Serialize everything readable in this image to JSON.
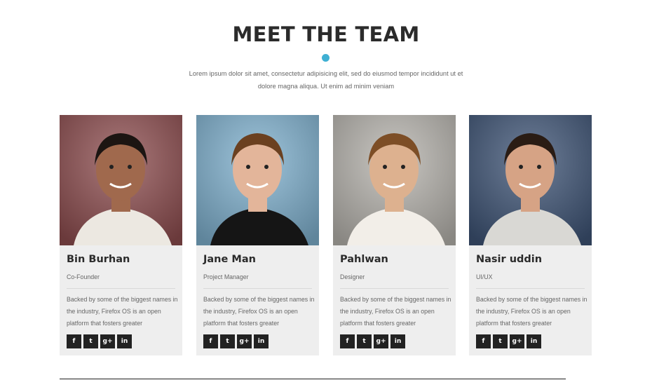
{
  "section": {
    "title": "MEET THE TEAM",
    "intro": "Lorem ipsum dolor sit amet, consectetur adipisicing elit, sed do eiusmod tempor incididunt ut et dolore magna aliqua. Ut enim ad minim veniam",
    "accent_color": "#3fb0d3"
  },
  "social_icons": [
    {
      "icon": "facebook-icon",
      "glyph": "f"
    },
    {
      "icon": "twitter-icon",
      "glyph": "t"
    },
    {
      "icon": "google-plus-icon",
      "glyph": "g+"
    },
    {
      "icon": "linkedin-icon",
      "glyph": "in"
    }
  ],
  "members": [
    {
      "name": "Bin Burhan",
      "role": "Co-Founder",
      "bio": "Backed by some of the biggest names in the industry, Firefox OS is an open platform that fosters greater",
      "photo_bg": "#8e4d4f",
      "skin": "#a0694d",
      "hair": "#1c1512",
      "shirt": "#ece8e1"
    },
    {
      "name": "Jane Man",
      "role": "Project Manager",
      "bio": "Backed by some of the biggest names in the industry, Firefox OS is an open platform that fosters greater",
      "photo_bg": "#7fb1cf",
      "skin": "#e3b59a",
      "hair": "#6b4020",
      "shirt": "#151515"
    },
    {
      "name": "Pahlwan",
      "role": "Designer",
      "bio": "Backed by some of the biggest names in the industry, Firefox OS is an open platform that fosters greater",
      "photo_bg": "#b7b4ae",
      "skin": "#ddb18f",
      "hair": "#7d4e26",
      "shirt": "#f2eee8"
    },
    {
      "name": "Nasir uddin",
      "role": "UI/UX",
      "bio": "Backed by some of the biggest names in the industry, Firefox OS is an open platform that fosters greater",
      "photo_bg": "#3e5476",
      "skin": "#d6a385",
      "hair": "#2a1c14",
      "shirt": "#d9d8d4"
    }
  ]
}
